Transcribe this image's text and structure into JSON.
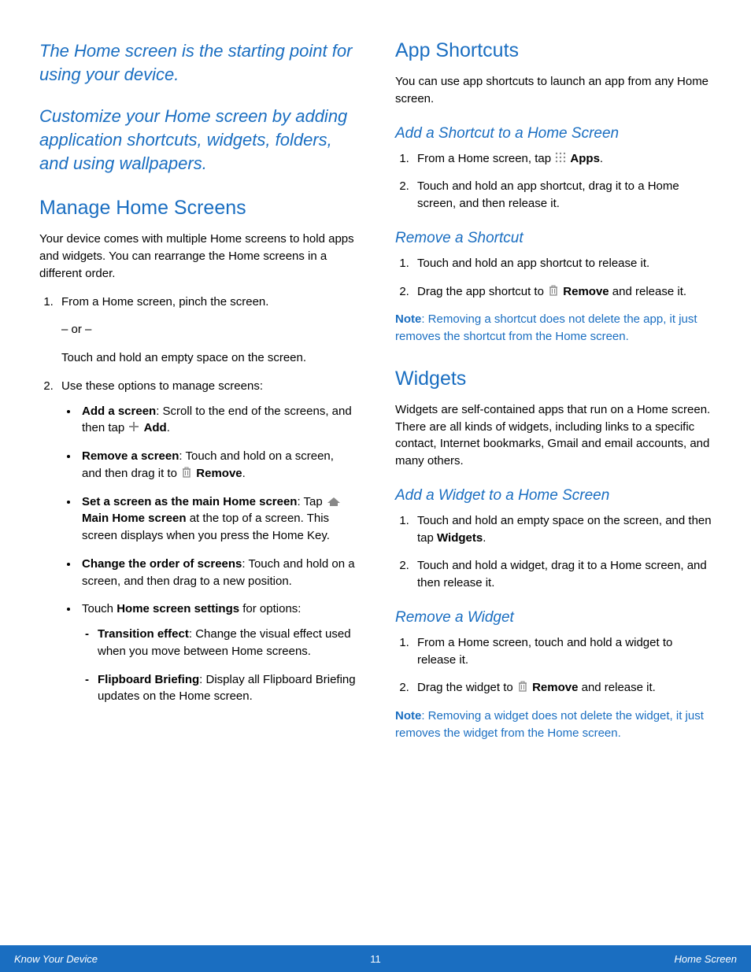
{
  "intro1": "The Home screen is the starting point for using your device.",
  "intro2": "Customize your Home screen by adding application shortcuts, widgets, folders, and using wallpapers.",
  "left": {
    "h2": "Manage Home Screens",
    "p1": "Your device comes with multiple Home screens to hold apps and widgets. You can rearrange the Home screens in a different order.",
    "step1": "From a Home screen, pinch the screen.",
    "or": "– or –",
    "step1b": "Touch and hold an empty space on the screen.",
    "step2_lead": "Use these options to manage screens:",
    "b1_label": "Add a screen",
    "b1_a": ": Scroll to the end of the screens, and then tap ",
    "b1_b": "Add",
    "b1_c": ".",
    "b2_label": "Remove a screen",
    "b2_a": ": Touch and hold on a screen, and then drag it to ",
    "b2_b": "Remove",
    "b2_c": ".",
    "b3_label": "Set a screen as the main Home screen",
    "b3_a": ": Tap ",
    "b3_b": "Main Home screen",
    "b3_c": " at the top of a screen. This screen displays when you press the Home Key.",
    "b4_label": "Change the order of screens",
    "b4_a": ": Touch and hold on a screen, and then drag to a new position.",
    "b5_a": "Touch ",
    "b5_b": "Home screen settings",
    "b5_c": " for options:",
    "d1_label": "Transition effect",
    "d1_a": ": Change the visual effect used when you move between Home screens.",
    "d2_label": "Flipboard Briefing",
    "d2_a": ": Display all Flipboard Briefing updates on the Home screen."
  },
  "right": {
    "h2a": "App Shortcuts",
    "p_a": "You can use app shortcuts to launch an app from any Home screen.",
    "h3a": "Add a Shortcut to a Home Screen",
    "a1_a": "From a Home screen, tap ",
    "a1_b": "Apps",
    "a1_c": ".",
    "a2": "Touch and hold an app shortcut, drag it to a Home screen, and then release it.",
    "h3b": "Remove a Shortcut",
    "r1": "Touch and hold an app shortcut to release it.",
    "r2_a": "Drag the app shortcut to ",
    "r2_b": "Remove",
    "r2_c": " and release it.",
    "note1_label": "Note",
    "note1": ": Removing a shortcut does not delete the app, it just removes the shortcut from the Home screen.",
    "h2b": "Widgets",
    "p_b": "Widgets are self-contained apps that run on a Home screen. There are all kinds of widgets, including links to a specific contact, Internet bookmarks, Gmail and email accounts, and many others.",
    "h3c": "Add a Widget to a Home Screen",
    "w1_a": "Touch and hold an empty space on the screen, and then tap ",
    "w1_b": "Widgets",
    "w1_c": ".",
    "w2": "Touch and hold a widget, drag it to a Home screen, and then release it.",
    "h3d": "Remove a Widget",
    "rw1": "From a Home screen, touch and hold a widget to release it.",
    "rw2_a": "Drag the widget to ",
    "rw2_b": "Remove",
    "rw2_c": " and release it.",
    "note2_label": "Note",
    "note2": ": Removing a widget does not delete the widget, it just removes the widget from the Home screen."
  },
  "footer": {
    "left": "Know Your Device",
    "center": "11",
    "right": "Home Screen"
  }
}
